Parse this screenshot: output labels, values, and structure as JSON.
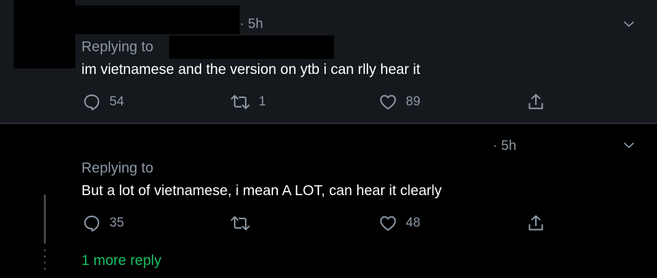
{
  "tweets": [
    {
      "time": "· 5h",
      "replying_to": "Replying to",
      "text": "im vietnamese and the version on ytb i can rlly hear it",
      "reply_count": "54",
      "retweet_count": "1",
      "like_count": "89"
    },
    {
      "time": "· 5h",
      "replying_to": "Replying to",
      "text": "But a lot of vietnamese, i mean A LOT, can hear it clearly",
      "reply_count": "35",
      "retweet_count": "",
      "like_count": "48"
    }
  ],
  "thread": {
    "more_reply": "1 more reply"
  },
  "colors": {
    "background": "#000000",
    "highlighted_tweet_bg": "#15181c",
    "secondary_text": "#8b98a5",
    "primary_text": "#ffffff",
    "more_reply_green": "#17bf63",
    "divider": "#2f3336"
  },
  "icons": [
    "reply-icon",
    "retweet-icon",
    "like-icon",
    "share-icon",
    "chevron-down-icon"
  ]
}
